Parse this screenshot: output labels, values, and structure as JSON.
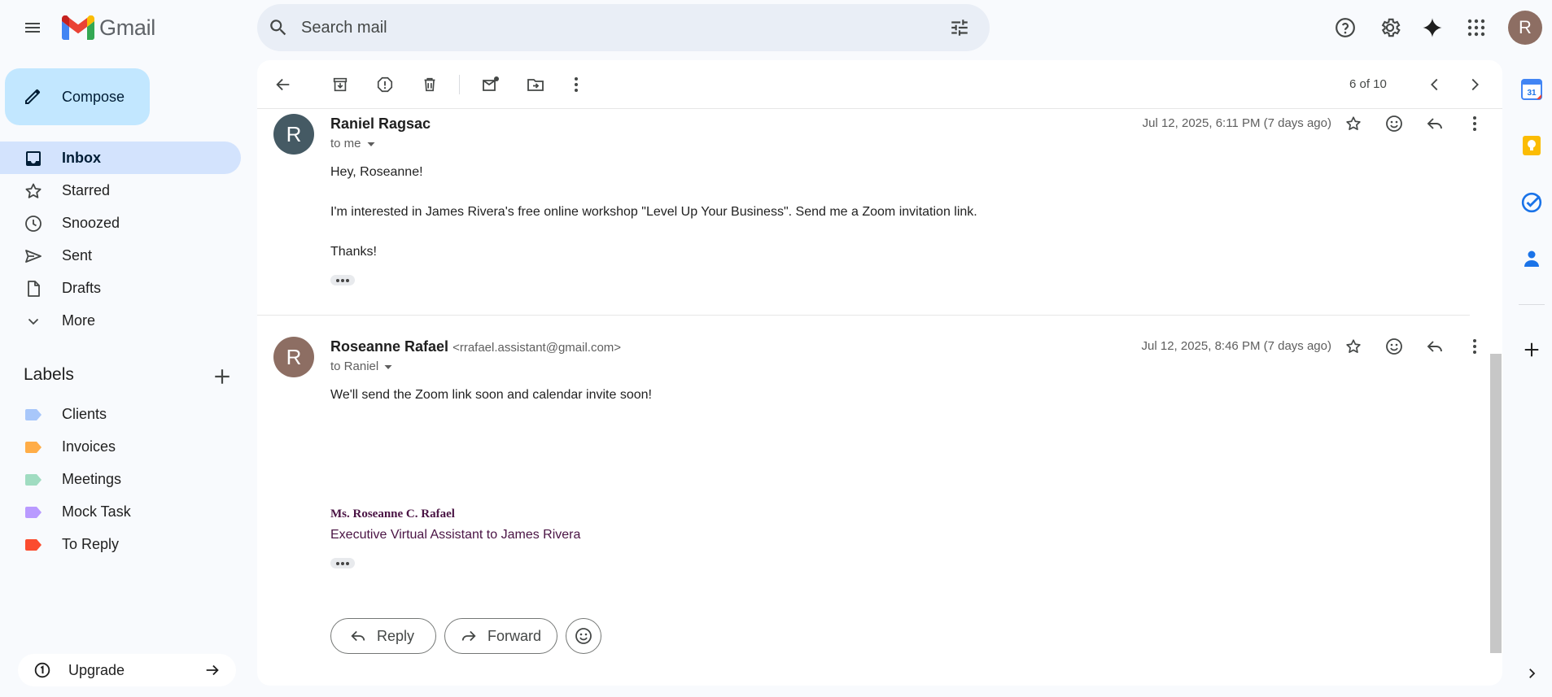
{
  "app": {
    "name": "Gmail",
    "avatar_letter": "R"
  },
  "search": {
    "placeholder": "Search mail"
  },
  "compose": {
    "label": "Compose"
  },
  "nav": [
    {
      "label": "Inbox",
      "icon": "inbox-icon",
      "active": true
    },
    {
      "label": "Starred",
      "icon": "star-icon"
    },
    {
      "label": "Snoozed",
      "icon": "clock-icon"
    },
    {
      "label": "Sent",
      "icon": "send-icon"
    },
    {
      "label": "Drafts",
      "icon": "draft-icon"
    },
    {
      "label": "More",
      "icon": "chevron-down-icon"
    }
  ],
  "labels": {
    "title": "Labels",
    "items": [
      {
        "label": "Clients",
        "color": "#a8c7fa"
      },
      {
        "label": "Invoices",
        "color": "#ffad47"
      },
      {
        "label": "Meetings",
        "color": "#a0dcc1"
      },
      {
        "label": "Mock Task",
        "color": "#b99aff"
      },
      {
        "label": "To Reply",
        "color": "#fb4c2f"
      }
    ]
  },
  "upgrade": {
    "label": "Upgrade"
  },
  "toolbar": {
    "pager": "6 of 10"
  },
  "messages": [
    {
      "avatar_letter": "R",
      "avatar_color": "#455a64",
      "sender": "Raniel Ragsac",
      "to": "to me",
      "date": "Jul 12, 2025, 6:11 PM (7 days ago)",
      "body": [
        "Hey, Roseanne!",
        "I'm interested in James Rivera's free online workshop \"Level Up Your Business\". Send me a Zoom invitation link.",
        "Thanks!"
      ]
    },
    {
      "avatar_letter": "R",
      "avatar_color": "#8d6e63",
      "sender": "Roseanne Rafael",
      "sender_email": "<rrafael.assistant@gmail.com>",
      "to": "to Raniel",
      "date": "Jul 12, 2025, 8:46 PM (7 days ago)",
      "body": [
        "We'll send the Zoom link soon and calendar invite soon!"
      ],
      "signature": {
        "name": "Ms. Roseanne C. Rafael",
        "title": "Executive Virtual Assistant to James Rivera"
      }
    }
  ],
  "actions": {
    "reply": "Reply",
    "forward": "Forward"
  },
  "rail": {
    "calendar_day": "31"
  }
}
